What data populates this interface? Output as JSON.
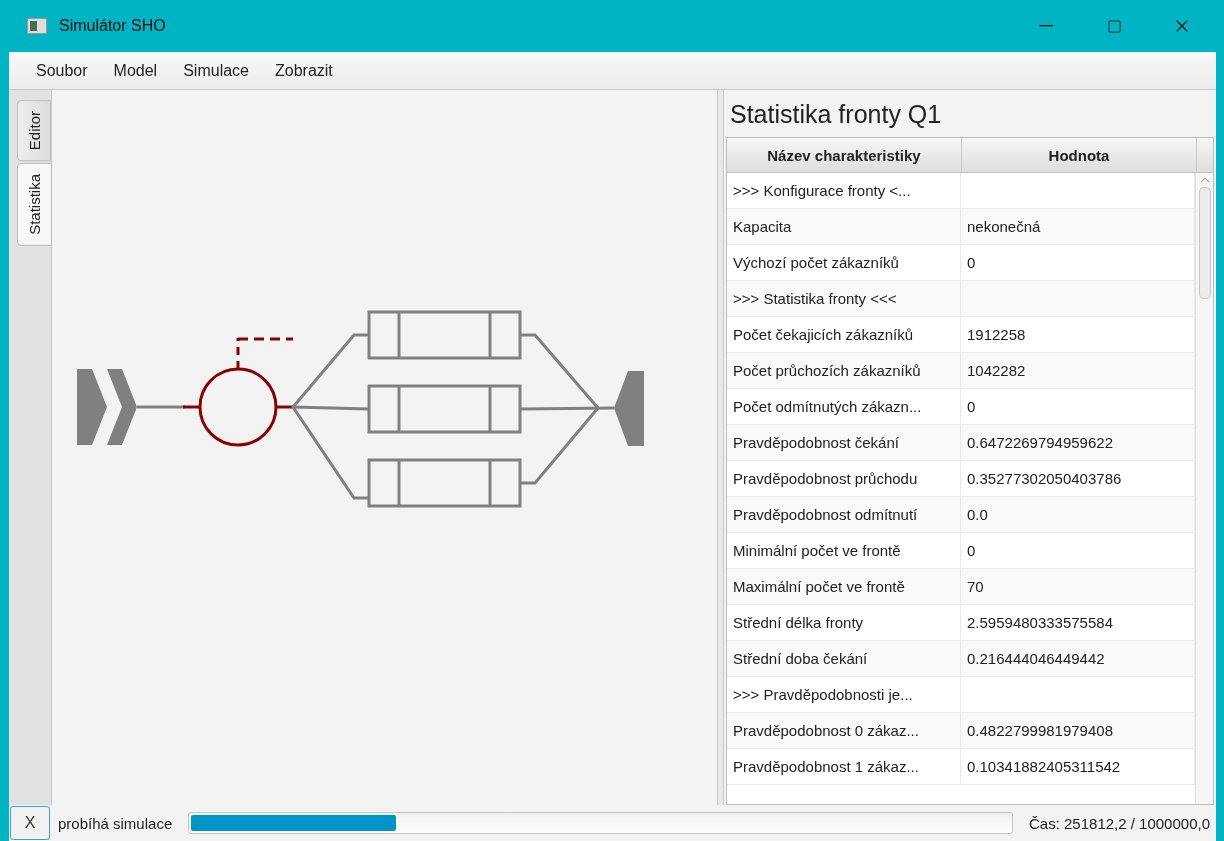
{
  "window": {
    "title": "Simulátor SHO"
  },
  "menu": [
    "Soubor",
    "Model",
    "Simulace",
    "Zobrazit"
  ],
  "tabs": [
    {
      "label": "Editor",
      "selected": false
    },
    {
      "label": "Statistika",
      "selected": true
    }
  ],
  "diagram": {
    "nodes": [
      {
        "kind": "source",
        "selected": false
      },
      {
        "kind": "queue",
        "selected": true
      },
      {
        "kind": "server",
        "selected": false
      },
      {
        "kind": "server",
        "selected": false
      },
      {
        "kind": "server",
        "selected": false
      },
      {
        "kind": "sink",
        "selected": false
      }
    ]
  },
  "panel": {
    "title": "Statistika fronty Q1",
    "table": {
      "columns": [
        "Název charakteristiky",
        "Hodnota"
      ],
      "rows": [
        [
          ">>> Konfigurace fronty <...",
          ""
        ],
        [
          "Kapacita",
          "nekonečná"
        ],
        [
          "Výchozí počet zákazníků",
          "0"
        ],
        [
          ">>> Statistika fronty <<<",
          ""
        ],
        [
          "Počet čekajicích zákazníků",
          "1912258"
        ],
        [
          "Počet průchozích zákazníků",
          "1042282"
        ],
        [
          "Počet odmítnutých zákazn...",
          "0"
        ],
        [
          "Pravděpodobnost čekání",
          "0.6472269794959622"
        ],
        [
          "Pravděpodobnost průchodu",
          "0.35277302050403786"
        ],
        [
          "Pravděpodobnost odmítnutí",
          "0.0"
        ],
        [
          "Minimální počet ve frontě",
          "0"
        ],
        [
          "Maximální počet ve frontě",
          "70"
        ],
        [
          "Střední délka fronty",
          "2.5959480333575584"
        ],
        [
          "Střední doba čekání",
          "0.216444046449442"
        ],
        [
          ">>> Pravděpodobnosti je...",
          ""
        ],
        [
          "Pravděpodobnost 0 zákaz...",
          "0.4822799981979408"
        ],
        [
          "Pravděpodobnost 1 zákaz...",
          "0.10341882405311542"
        ]
      ]
    }
  },
  "status_bar": {
    "stop_button": "X",
    "message": "probíhá simulace",
    "progress": {
      "level": 0.25
    },
    "time": "Čas: 251812,2 / 1000000,0"
  }
}
